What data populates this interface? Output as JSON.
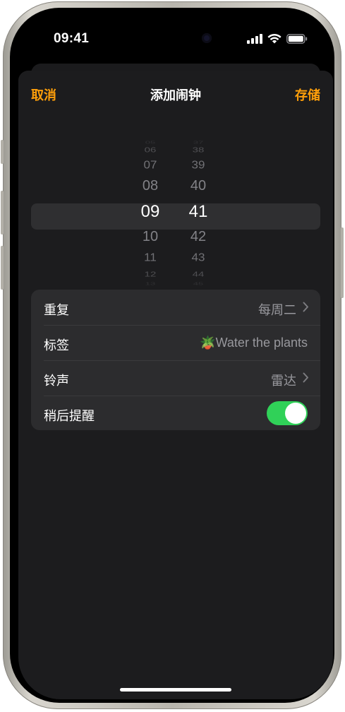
{
  "status": {
    "time": "09:41"
  },
  "nav": {
    "cancel": "取消",
    "title": "添加闹钟",
    "save": "存储"
  },
  "picker": {
    "hours": [
      "05",
      "06",
      "07",
      "08",
      "09",
      "10",
      "11",
      "12",
      "13"
    ],
    "minutes": [
      "37",
      "38",
      "39",
      "40",
      "41",
      "42",
      "43",
      "44",
      "45"
    ],
    "selected_hour": "09",
    "selected_minute": "41"
  },
  "settings": {
    "repeat": {
      "label": "重复",
      "value": "每周二"
    },
    "label": {
      "label": "标签",
      "emoji": "🪴",
      "value": "Water the plants"
    },
    "sound": {
      "label": "铃声",
      "value": "雷达"
    },
    "snooze": {
      "label": "稍后提醒",
      "on": true
    }
  },
  "colors": {
    "accent": "#ff9f0a",
    "toggle_on": "#30d158",
    "sheet": "#1c1c1e",
    "card": "#2c2c2e"
  }
}
